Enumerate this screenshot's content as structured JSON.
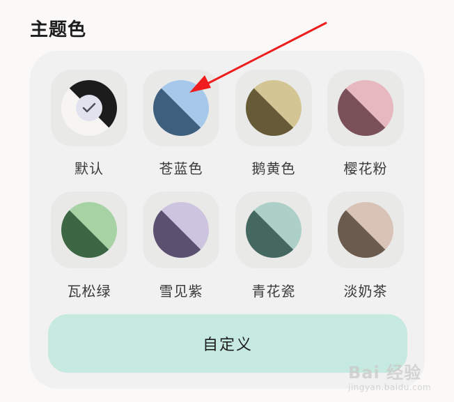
{
  "section": {
    "title": "主题色"
  },
  "themes": [
    {
      "label": "默认",
      "color_a": "#1c1c1c",
      "color_b": "#f7f5f2",
      "selected": true
    },
    {
      "label": "苍蓝色",
      "color_a": "#a6c8ea",
      "color_b": "#3e5f7d",
      "selected": false
    },
    {
      "label": "鹅黄色",
      "color_a": "#d4c594",
      "color_b": "#675a37",
      "selected": false
    },
    {
      "label": "樱花粉",
      "color_a": "#e8b8c1",
      "color_b": "#7a5158",
      "selected": false
    },
    {
      "label": "瓦松绿",
      "color_a": "#a7d3a4",
      "color_b": "#3d6643",
      "selected": false
    },
    {
      "label": "雪见紫",
      "color_a": "#cdc4df",
      "color_b": "#5b5070",
      "selected": false
    },
    {
      "label": "青花瓷",
      "color_a": "#acd0c7",
      "color_b": "#446760",
      "selected": false
    },
    {
      "label": "淡奶茶",
      "color_a": "#d9c3b6",
      "color_b": "#6b5a4e",
      "selected": false
    }
  ],
  "custom_button": {
    "label": "自定义"
  },
  "annotation": {
    "arrow_color": "#ee1c1c"
  },
  "watermark": {
    "brand": "Bai 经验",
    "url": "jingyan.baidu.com"
  }
}
